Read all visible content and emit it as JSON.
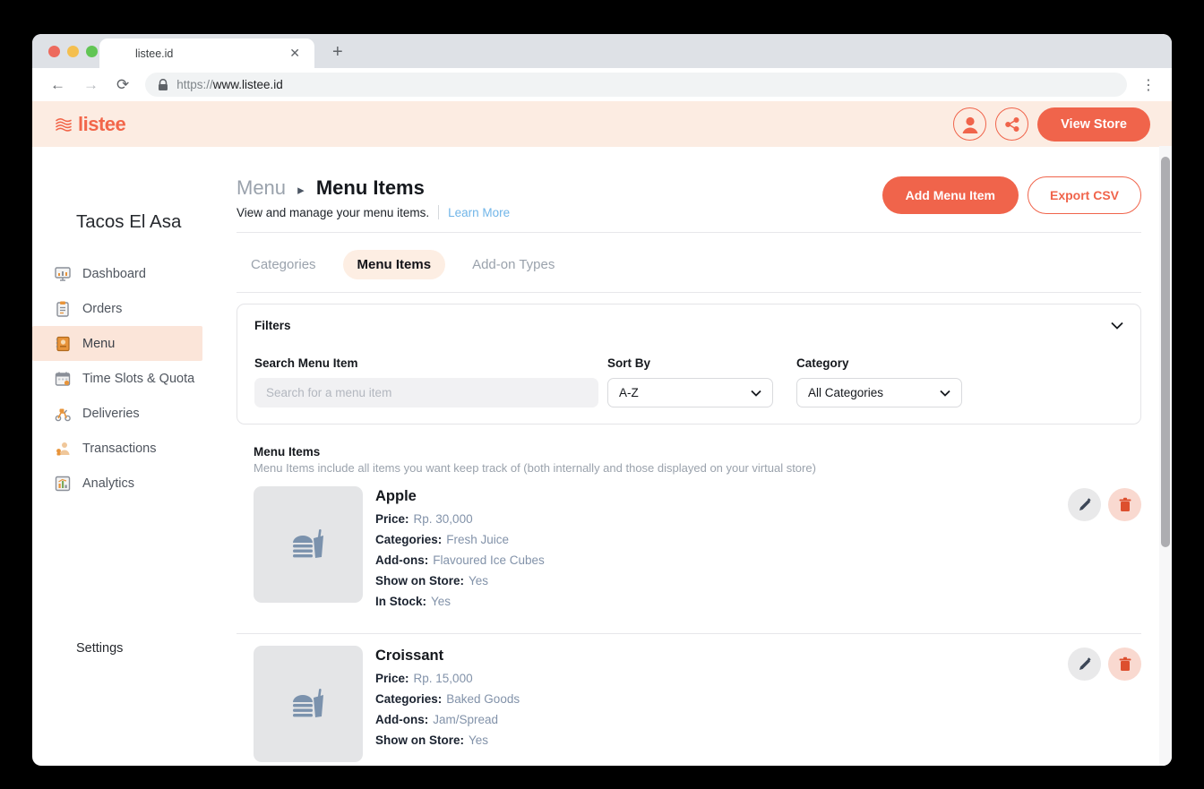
{
  "browser": {
    "tab_title": "listee.id",
    "close_tab_glyph": "✕",
    "new_tab_glyph": "+",
    "back_glyph": "←",
    "forward_glyph": "→",
    "reload_glyph": "⟳",
    "kebab_glyph": "⋮",
    "url_protocol": "https://",
    "url_host": "www.listee.id"
  },
  "header": {
    "logo_text": "listee",
    "view_store_label": "View Store",
    "icons": [
      "layers-icon",
      "person-icon",
      "share-icon"
    ]
  },
  "sidebar": {
    "store_name": "Tacos El Asa",
    "items": [
      {
        "label": "Dashboard",
        "icon": "dashboard-icon",
        "active": false
      },
      {
        "label": "Orders",
        "icon": "orders-icon",
        "active": false
      },
      {
        "label": "Menu",
        "icon": "menu-book-icon",
        "active": true
      },
      {
        "label": "Time Slots & Quota",
        "icon": "calendar-icon",
        "active": false
      },
      {
        "label": "Deliveries",
        "icon": "scooter-icon",
        "active": false
      },
      {
        "label": "Transactions",
        "icon": "transactions-icon",
        "active": false
      },
      {
        "label": "Analytics",
        "icon": "analytics-icon",
        "active": false
      }
    ],
    "settings_label": "Settings"
  },
  "page": {
    "breadcrumb_parent": "Menu",
    "breadcrumb_current": "Menu Items",
    "subtitle": "View and manage your menu items.",
    "learn_more_label": "Learn More",
    "add_button_label": "Add Menu Item",
    "export_button_label": "Export CSV",
    "tabs": [
      {
        "label": "Categories",
        "active": false
      },
      {
        "label": "Menu Items",
        "active": true
      },
      {
        "label": "Add-on Types",
        "active": false
      }
    ]
  },
  "filters": {
    "title": "Filters",
    "search_label": "Search Menu Item",
    "search_placeholder": "Search for a menu item",
    "sort_label": "Sort By",
    "sort_value": "A-Z",
    "category_label": "Category",
    "category_value": "All Categories"
  },
  "list": {
    "heading": "Menu Items",
    "description": "Menu Items include all items you want keep track of (both internally and those displayed on your virtual store)",
    "items": [
      {
        "name": "Apple",
        "rows": [
          {
            "label": "Price:",
            "value": "Rp. 30,000"
          },
          {
            "label": "Categories:",
            "value": "Fresh Juice"
          },
          {
            "label": "Add-ons:",
            "value": "Flavoured Ice Cubes"
          },
          {
            "label": "Show on Store:",
            "value": "Yes"
          },
          {
            "label": "In Stock:",
            "value": "Yes"
          }
        ]
      },
      {
        "name": "Croissant",
        "rows": [
          {
            "label": "Price:",
            "value": "Rp. 15,000"
          },
          {
            "label": "Categories:",
            "value": "Baked Goods"
          },
          {
            "label": "Add-ons:",
            "value": "Jam/Spread"
          },
          {
            "label": "Show on Store:",
            "value": "Yes"
          }
        ]
      }
    ]
  },
  "colors": {
    "accent_coral": "#f0644b",
    "header_peach": "#fcece2",
    "active_nav_bg": "#fbe5d9",
    "tab_pill_bg": "#fdeee3",
    "value_slate": "#8292a9",
    "link_blue": "#70b5e8",
    "delete_red": "#dd4f2e",
    "placeholder_icon_blue": "#7b92ad"
  }
}
